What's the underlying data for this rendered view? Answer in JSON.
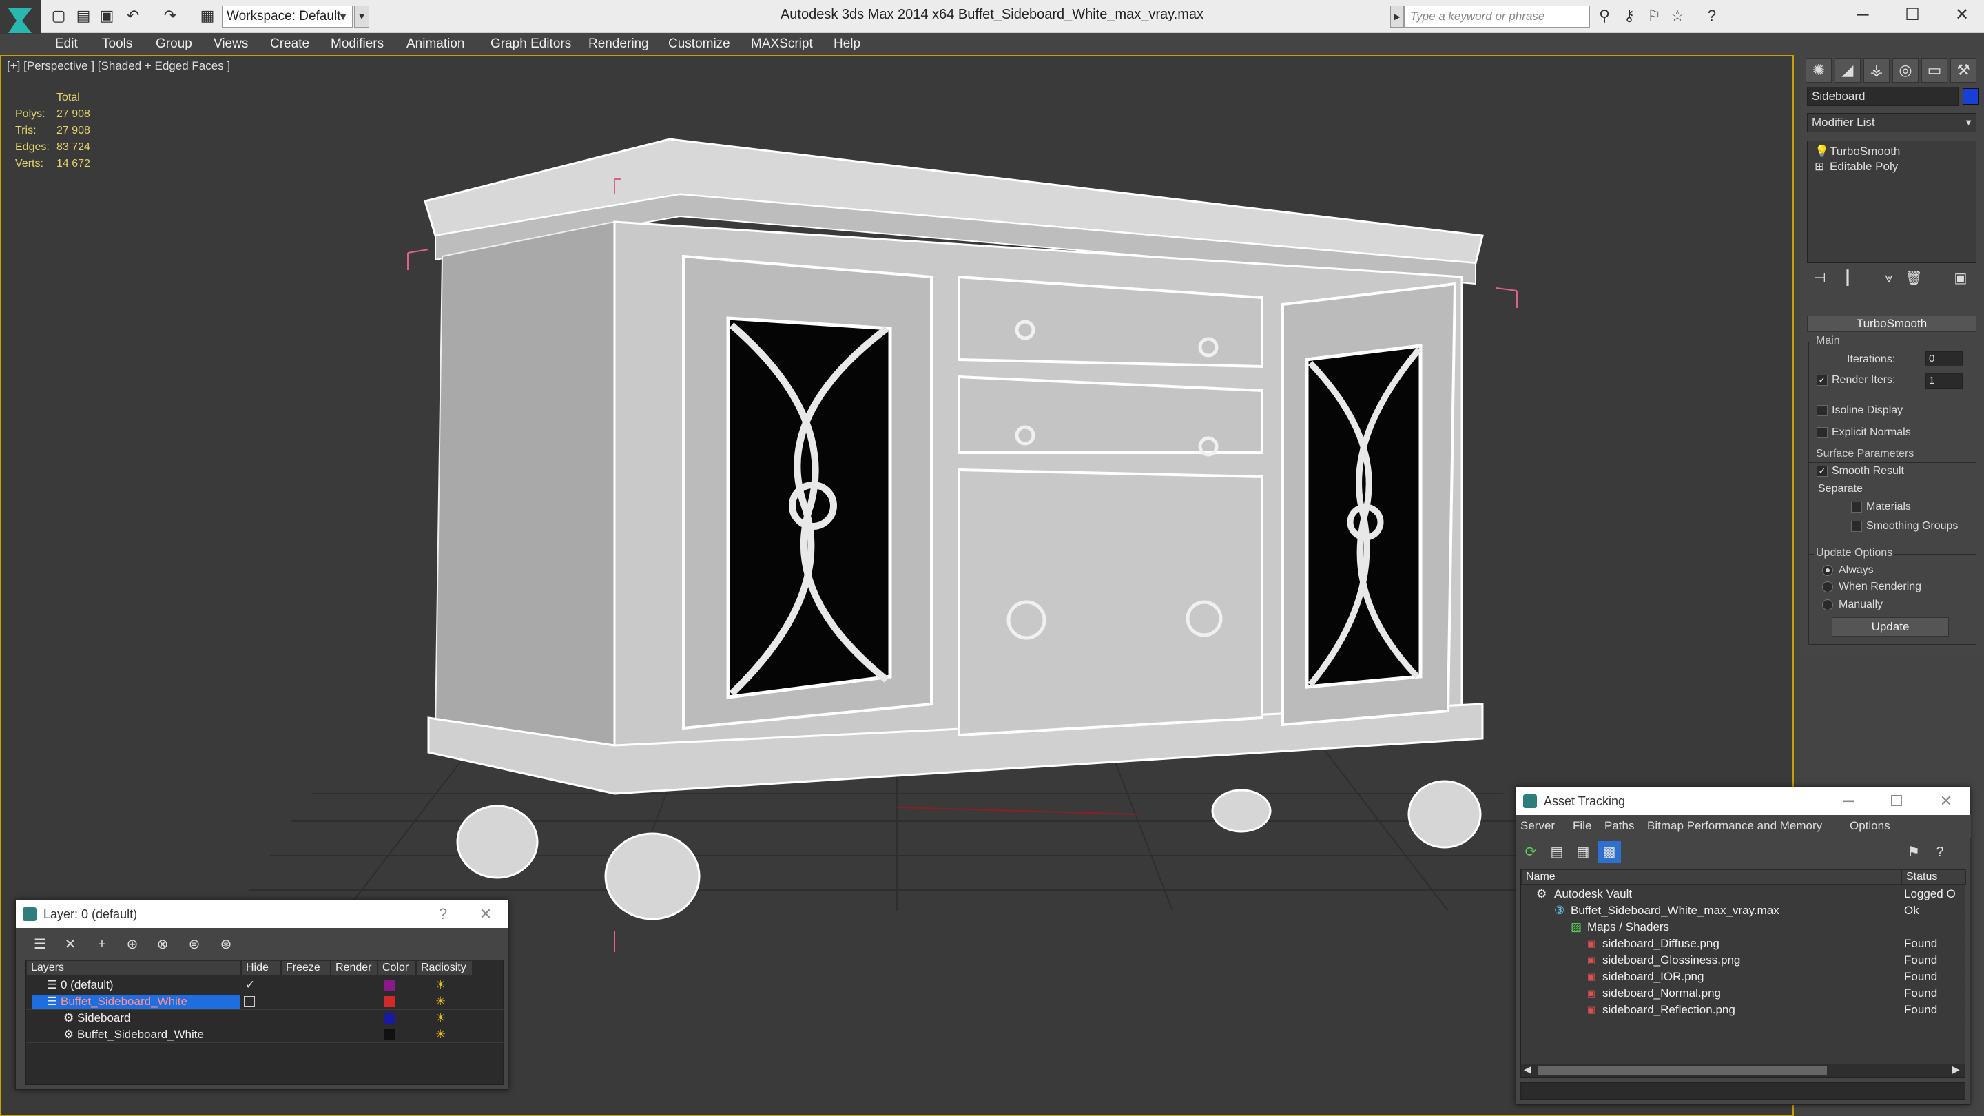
{
  "app": {
    "title": "Autodesk 3ds Max 2014 x64     Buffet_Sideboard_White_max_vray.max",
    "workspace": "Workspace: Default",
    "search_placeholder": "Type a keyword or phrase"
  },
  "menu": [
    "Edit",
    "Tools",
    "Group",
    "Views",
    "Create",
    "Modifiers",
    "Animation",
    "Graph Editors",
    "Rendering",
    "Customize",
    "MAXScript",
    "Help"
  ],
  "viewport": {
    "label": "[+] [Perspective ] [Shaded + Edged Faces ]",
    "stats": {
      "header": "Total",
      "rows": [
        {
          "k": "Polys:",
          "v": "27 908"
        },
        {
          "k": "Tris:",
          "v": "27 908"
        },
        {
          "k": "Edges:",
          "v": "83 724"
        },
        {
          "k": "Verts:",
          "v": "14 672"
        }
      ]
    }
  },
  "command_panel": {
    "object_name": "Sideboard",
    "object_color": "#1a3fd6",
    "modifier_list": "Modifier List",
    "stack": [
      "TurboSmooth",
      "Editable Poly"
    ],
    "rollout": "TurboSmooth",
    "main": "Main",
    "iterations_label": "Iterations:",
    "iterations": "0",
    "render_iters_label": "Render Iters:",
    "render_iters": "1",
    "isoline": "Isoline Display",
    "explicit": "Explicit Normals",
    "surface": "Surface Parameters",
    "smooth": "Smooth Result",
    "separate": "Separate",
    "materials": "Materials",
    "smoothing": "Smoothing Groups",
    "update_options": "Update Options",
    "always": "Always",
    "when_rendering": "When Rendering",
    "manually": "Manually",
    "update": "Update"
  },
  "layer_window": {
    "title": "Layer: 0 (default)",
    "columns": [
      "Layers",
      "Hide",
      "Freeze",
      "Render",
      "Color",
      "Radiosity"
    ],
    "rows": [
      {
        "name": "0 (default)",
        "color": "#8a1a8a"
      },
      {
        "name": "Buffet_Sideboard_White",
        "color": "#d02a2a"
      },
      {
        "name": "Sideboard",
        "color": "#1a1aa0"
      },
      {
        "name": "Buffet_Sideboard_White",
        "color": "#111111"
      }
    ]
  },
  "asset_window": {
    "title": "Asset Tracking",
    "menu": [
      "Server",
      "File",
      "Paths",
      "Bitmap Performance and Memory",
      "Options"
    ],
    "columns": [
      "Name",
      "Status"
    ],
    "rows": [
      {
        "name": "Autodesk Vault",
        "status": "Logged O"
      },
      {
        "name": "Buffet_Sideboard_White_max_vray.max",
        "status": "Ok"
      },
      {
        "name": "Maps / Shaders",
        "status": ""
      },
      {
        "name": "sideboard_Diffuse.png",
        "status": "Found"
      },
      {
        "name": "sideboard_Glossiness.png",
        "status": "Found"
      },
      {
        "name": "sideboard_IOR.png",
        "status": "Found"
      },
      {
        "name": "sideboard_Normal.png",
        "status": "Found"
      },
      {
        "name": "sideboard_Reflection.png",
        "status": "Found"
      }
    ]
  },
  "colors": {
    "accent": "#c8a000",
    "selection": "#1e6ee0",
    "stats": "#e3d36a"
  }
}
